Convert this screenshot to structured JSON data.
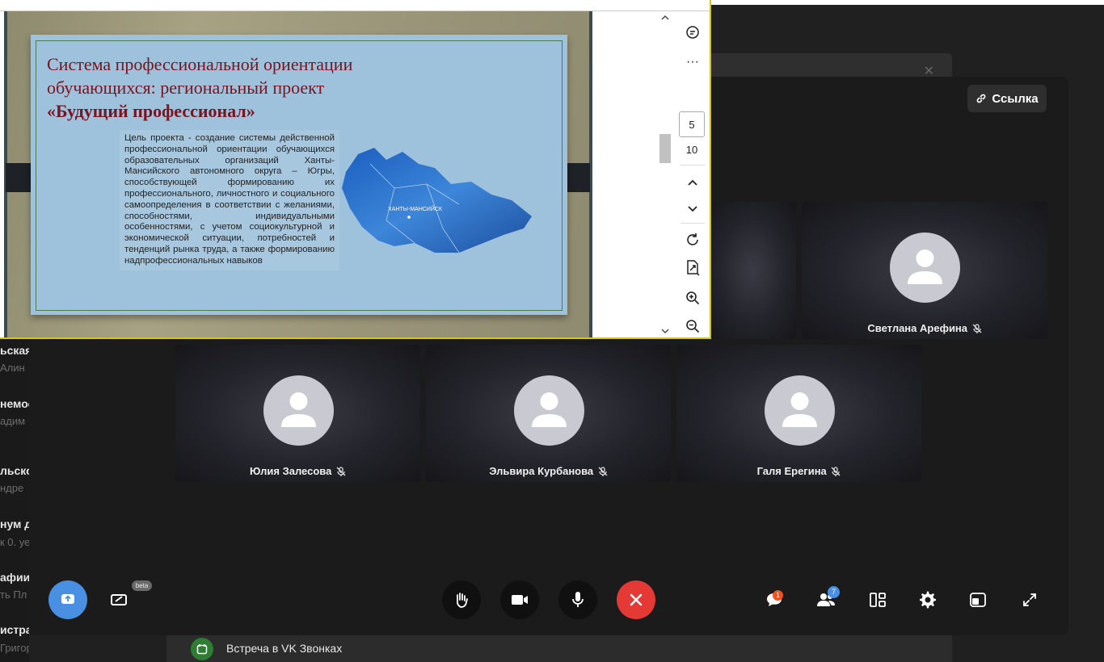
{
  "background": {
    "left_list": [
      {
        "title": "ьская",
        "subtitle": "Алин"
      },
      {
        "title": "немос",
        "subtitle": "адим"
      },
      {
        "title": "льско",
        "subtitle": "ндре"
      },
      {
        "title": "нум д",
        "subtitle": "к 0. уе"
      },
      {
        "title": "афии",
        "subtitle": "ть Пл"
      },
      {
        "title": "истрац",
        "subtitle": "Григорьевна Б: Их нет в эт"
      }
    ],
    "meeting_bar_title": "Встреча в VK Звонках"
  },
  "call": {
    "link_button_label": "Ссылка",
    "participants": [
      {
        "name": "Светлана Арефина",
        "muted": true
      },
      {
        "name": "Юлия Залесова",
        "muted": true
      },
      {
        "name": "Эльвира Курбанова",
        "muted": true
      },
      {
        "name": "Галя Ерегина",
        "muted": true
      }
    ],
    "toolbar": {
      "beta_label": "beta",
      "chat_badge": "1",
      "participants_badge": "7",
      "end_color": "#e53935",
      "share_color": "#4a90e2"
    }
  },
  "pdf_viewer": {
    "slide": {
      "title_line1": "Система профессиональной ориентации",
      "title_line2": "обучающихся: региональный проект",
      "title_line3": "«Будущий профессионал»",
      "body": "Цель проекта - создание системы действенной профессиональной ориентации обучающихся образовательных организаций Ханты-Мансийского автономного округа – Югры, способствующей формированию их профессионального, личностного и социального самоопределения в соответствии с желаниями, способностями, индивидуальными особенностями, с учетом социокультурной и экономической ситуации, потребностей и тенденций рынка труда, а также формированию надпрофессиональных навыков",
      "map_label": "ХАНТЫ-МАНСИЙСК"
    },
    "current_page": "5",
    "total_pages": "10"
  }
}
